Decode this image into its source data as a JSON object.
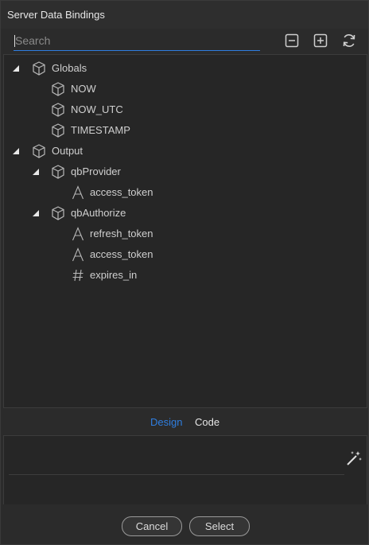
{
  "window": {
    "title": "Server Data Bindings"
  },
  "search": {
    "placeholder": "Search"
  },
  "toolbar": {
    "collapse_all": "minus-square-icon",
    "expand_all": "plus-square-icon",
    "refresh": "refresh-icon"
  },
  "tree": [
    {
      "label": "Globals",
      "icon": "cube-icon",
      "expanded": true
    },
    {
      "label": "NOW",
      "icon": "cube-icon"
    },
    {
      "label": "NOW_UTC",
      "icon": "cube-icon"
    },
    {
      "label": "TIMESTAMP",
      "icon": "cube-icon"
    },
    {
      "label": "Output",
      "icon": "cube-icon",
      "expanded": true
    },
    {
      "label": "qbProvider",
      "icon": "cube-icon",
      "expanded": true
    },
    {
      "label": "access_token",
      "icon": "text-type-icon"
    },
    {
      "label": "qbAuthorize",
      "icon": "cube-icon",
      "expanded": true
    },
    {
      "label": "refresh_token",
      "icon": "text-type-icon"
    },
    {
      "label": "access_token",
      "icon": "text-type-icon"
    },
    {
      "label": "expires_in",
      "icon": "number-type-icon"
    }
  ],
  "tabs": [
    {
      "label": "Design",
      "active": true
    },
    {
      "label": "Code",
      "active": false
    }
  ],
  "editor": {
    "wand": "magic-wand-icon"
  },
  "buttons": {
    "cancel": "Cancel",
    "select": "Select"
  },
  "colors": {
    "accent": "#2f7ee0",
    "background": "#262626"
  }
}
